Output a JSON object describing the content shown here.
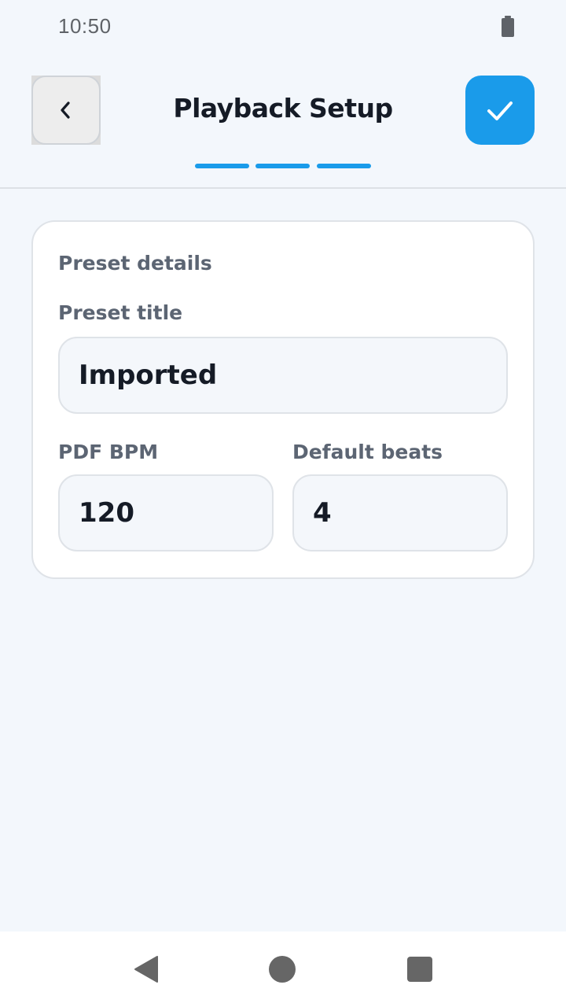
{
  "status_bar": {
    "time": "10:50",
    "battery_icon": "battery-full-icon"
  },
  "header": {
    "title": "Playback Setup",
    "back_icon": "chevron-left-icon",
    "confirm_icon": "check-icon",
    "progress_steps_total": 3,
    "progress_steps_done": 3
  },
  "card": {
    "section_title": "Preset details",
    "preset_title": {
      "label": "Preset title",
      "value": "Imported"
    },
    "bpm": {
      "label": "PDF BPM",
      "value": "120"
    },
    "beats": {
      "label": "Default beats",
      "value": "4"
    }
  },
  "nav_bar": {
    "back_icon": "triangle-back-icon",
    "home_icon": "circle-home-icon",
    "recents_icon": "square-recents-icon"
  },
  "colors": {
    "accent": "#1a9bea",
    "background": "#f3f7fc",
    "card": "#ffffff",
    "label": "#5c6573"
  }
}
